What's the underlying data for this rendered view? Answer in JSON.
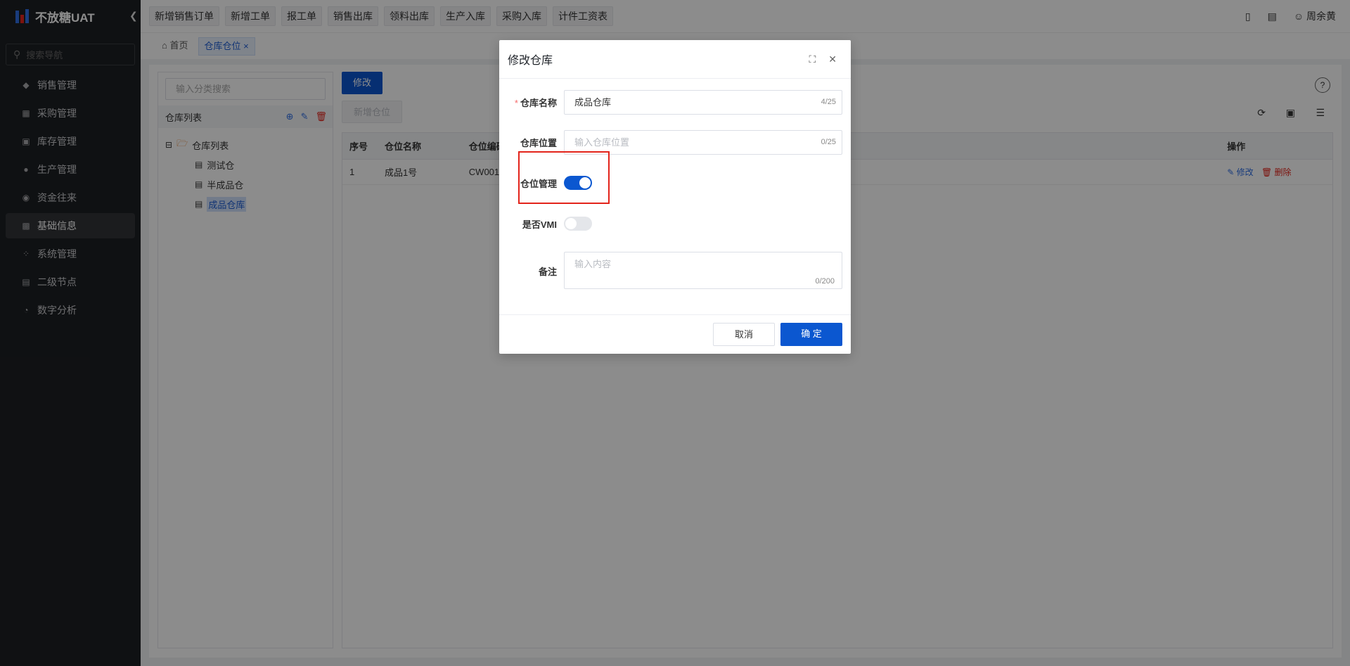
{
  "app": {
    "name": "不放糖UAT",
    "collapse_icon": "chevron-left-icon"
  },
  "nav": {
    "search_placeholder": "搜索导航",
    "items": [
      {
        "label": "销售管理",
        "icon": "tag-icon"
      },
      {
        "label": "采购管理",
        "icon": "cart-icon"
      },
      {
        "label": "库存管理",
        "icon": "warehouse-icon"
      },
      {
        "label": "生产管理",
        "icon": "flow-icon"
      },
      {
        "label": "资金往来",
        "icon": "coin-icon"
      },
      {
        "label": "基础信息",
        "icon": "grid-icon",
        "active": true
      },
      {
        "label": "系统管理",
        "icon": "apps-icon"
      },
      {
        "label": "二级节点",
        "icon": "doc-icon"
      },
      {
        "label": "数字分析",
        "icon": "pie-icon"
      }
    ]
  },
  "topbar": {
    "quick_links": [
      "新增销售订单",
      "新增工单",
      "报工单",
      "销售出库",
      "领料出库",
      "生产入库",
      "采购入库",
      "计件工资表"
    ],
    "user": "周余黄"
  },
  "tabs": {
    "home": "首页",
    "current": "仓库仓位"
  },
  "tree": {
    "search_placeholder": "输入分类搜索",
    "header": "仓库列表",
    "root": "仓库列表",
    "children": [
      "测试仓",
      "半成品仓",
      "成品仓库"
    ],
    "selected": "成品仓库"
  },
  "toolbar": {
    "edit": "修改",
    "add_location": "新增仓位"
  },
  "table": {
    "columns": [
      "序号",
      "仓位名称",
      "仓位编码",
      "操作"
    ],
    "rows": [
      {
        "index": "1",
        "name": "成品1号",
        "code": "CW001",
        "edit": "修改",
        "delete": "删除"
      }
    ]
  },
  "dialog": {
    "title": "修改仓库",
    "fields": {
      "name": {
        "label": "仓库名称",
        "value": "成品仓库",
        "count": "4/25"
      },
      "location": {
        "label": "仓库位置",
        "placeholder": "输入仓库位置",
        "count": "0/25"
      },
      "location_mgmt": {
        "label": "仓位管理",
        "on": true
      },
      "vmi": {
        "label": "是否VMI",
        "on": false
      },
      "remark": {
        "label": "备注",
        "placeholder": "输入内容",
        "count": "0/200"
      }
    },
    "cancel": "取消",
    "confirm": "确 定"
  },
  "colors": {
    "primary": "#0b57d0",
    "sidebar": "#1d1f23",
    "highlight": "#e3241b"
  }
}
